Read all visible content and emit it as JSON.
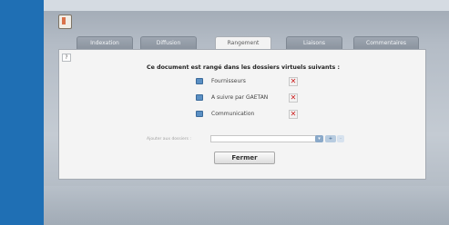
{
  "tabs": [
    {
      "label": "Indexation",
      "active": false
    },
    {
      "label": "Diffusion",
      "active": false
    },
    {
      "label": "Rangement",
      "active": true
    },
    {
      "label": "Liaisons",
      "active": false
    },
    {
      "label": "Commentaires",
      "active": false
    }
  ],
  "help_label": "?",
  "heading": "Ce document est rangé dans les dossiers virtuels suivants :",
  "folders": [
    {
      "label": "Fournisseurs"
    },
    {
      "label": "A suivre par GAETAN"
    },
    {
      "label": "Communication"
    }
  ],
  "remove_symbol": "✕",
  "add_folder": {
    "label": "Ajouter aux dossiers :",
    "value": "",
    "dropdown_symbol": "▾",
    "add_symbol": "+",
    "secondary_symbol": "·"
  },
  "close_label": "Fermer",
  "colors": {
    "background": "#1f6fb4",
    "panel": "#f4f4f4",
    "remove": "#cc1d1d"
  }
}
